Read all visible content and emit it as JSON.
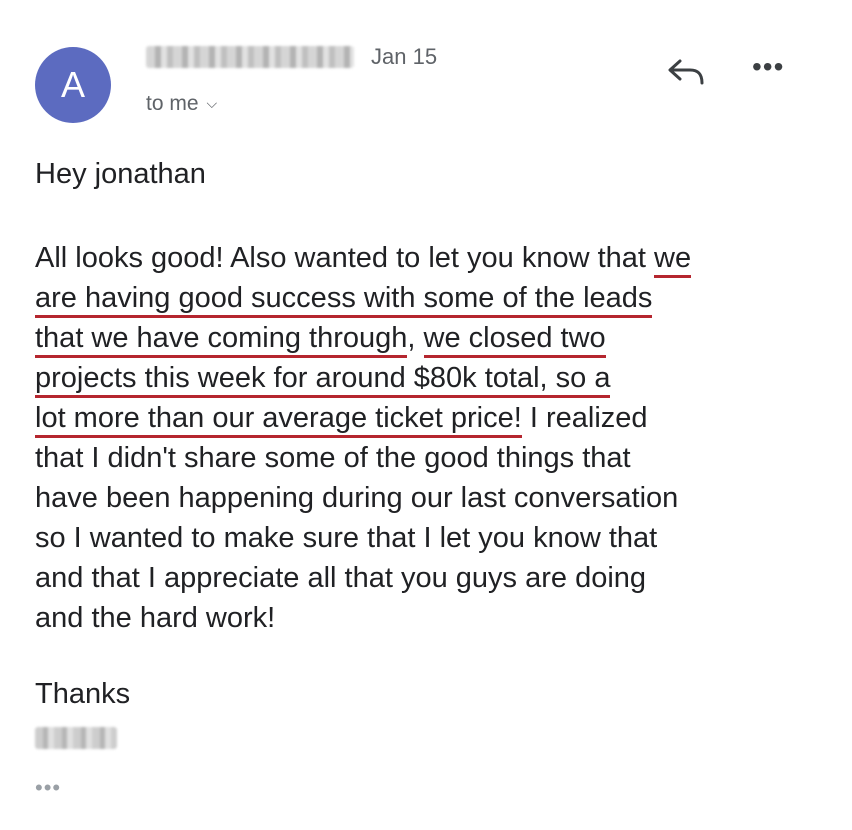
{
  "header": {
    "avatar_letter": "A",
    "date": "Jan 15",
    "recipient": "to me",
    "icons": [
      "reply-icon",
      "more-options-icon",
      "chevron-down-icon"
    ]
  },
  "message": {
    "greeting": "Hey jonathan",
    "lines": [
      {
        "segments": [
          {
            "text": "All looks good! Also wanted to let you know that ",
            "highlight": false
          },
          {
            "text": "we",
            "highlight": true
          }
        ]
      },
      {
        "segments": [
          {
            "text": "are having good success with some of the leads",
            "highlight": true
          }
        ]
      },
      {
        "segments": [
          {
            "text": "that we have coming through",
            "highlight": true
          },
          {
            "text": ", ",
            "highlight": false
          },
          {
            "text": "we closed two",
            "highlight": true
          }
        ]
      },
      {
        "segments": [
          {
            "text": "projects this week for around $80k total, so a",
            "highlight": true
          }
        ]
      },
      {
        "segments": [
          {
            "text": "lot more than our average ticket price!",
            "highlight": true
          },
          {
            "text": " I realized",
            "highlight": false
          }
        ]
      },
      {
        "segments": [
          {
            "text": "that I didn't share some of the good things that",
            "highlight": false
          }
        ]
      },
      {
        "segments": [
          {
            "text": "have been happening during our last conversation",
            "highlight": false
          }
        ]
      },
      {
        "segments": [
          {
            "text": "so I wanted to make sure that I let you know that",
            "highlight": false
          }
        ]
      },
      {
        "segments": [
          {
            "text": "and that I appreciate all that you guys are doing",
            "highlight": false
          }
        ]
      },
      {
        "segments": [
          {
            "text": "and the hard work!",
            "highlight": false
          }
        ]
      }
    ],
    "signoff": "Thanks",
    "more_indicator": "•••"
  },
  "colors": {
    "avatar": "#5c6bc0",
    "underline": "#b5262f",
    "meta_text": "#5f6368"
  }
}
